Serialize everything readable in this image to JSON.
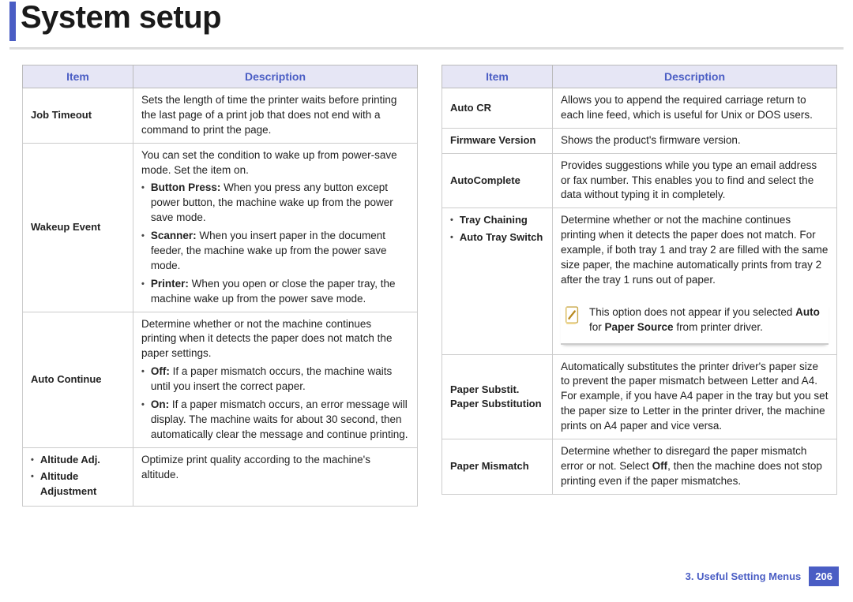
{
  "title": "System setup",
  "headers": {
    "item": "Item",
    "desc": "Description"
  },
  "left": {
    "r1": {
      "item": "Job Timeout",
      "desc": "Sets the length of time the printer waits before printing the last page of a print job that does not end with a command to print the page."
    },
    "r2": {
      "item": "Wakeup Event",
      "intro": "You can set the condition to wake up from power-save mode. Set the item on.",
      "b1_label": "Button Press:",
      "b1_text": " When you press any button except power button, the machine wake up from the power save mode.",
      "b2_label": "Scanner:",
      "b2_text": " When you insert paper in the document feeder, the machine wake up from the power save mode.",
      "b3_label": "Printer:",
      "b3_text": " When you open or close the paper tray, the machine wake up from the power save mode."
    },
    "r3": {
      "item": "Auto Continue",
      "intro": "Determine whether or not the machine continues printing when it detects the paper does not match the paper settings.",
      "b1_label": "Off:",
      "b1_text": " If a paper mismatch occurs, the machine waits until you insert the correct paper.",
      "b2_label": "On:",
      "b2_text": " If a paper mismatch occurs, an error message will display. The machine waits for about 30 second, then automatically clear the message and continue printing."
    },
    "r4": {
      "item1": "Altitude Adj.",
      "item2": "Altitude Adjustment",
      "desc": "Optimize print quality according to the machine's altitude."
    }
  },
  "right": {
    "r1": {
      "item": "Auto CR",
      "desc": "Allows you to append the required carriage return to each line feed, which is useful for Unix or DOS users."
    },
    "r2": {
      "item": "Firmware Version",
      "desc": "Shows the product's firmware version."
    },
    "r3": {
      "item": "AutoComplete",
      "desc": "Provides suggestions while you type an email address or fax number. This enables you to find and select the data without typing it in completely."
    },
    "r4": {
      "item1": "Tray Chaining",
      "item2": "Auto Tray Switch",
      "desc": "Determine whether or not the machine continues printing when it detects the paper does not match. For example, if both tray 1 and tray 2 are filled with the same size paper, the machine automatically prints from tray 2 after the tray 1 runs out of paper.",
      "note_pre": "This option does not appear if you selected ",
      "note_bold1": "Auto",
      "note_mid": " for ",
      "note_bold2": "Paper Source",
      "note_post": " from printer driver."
    },
    "r5": {
      "item1": "Paper Substit.",
      "item2": "Paper Substitution",
      "desc": "Automatically substitutes the printer driver's paper size to prevent the paper mismatch between Letter and A4. For example, if you have A4 paper in the tray but you set the paper size to Letter in the printer driver, the machine prints on A4 paper and vice versa."
    },
    "r6": {
      "item": "Paper Mismatch",
      "desc_pre": "Determine whether to disregard the paper mismatch error or not. Select ",
      "desc_bold": "Off",
      "desc_post": ", then the machine does not stop printing even if the paper mismatches."
    }
  },
  "footer": {
    "chapter": "3.  Useful Setting Menus",
    "page": "206"
  }
}
